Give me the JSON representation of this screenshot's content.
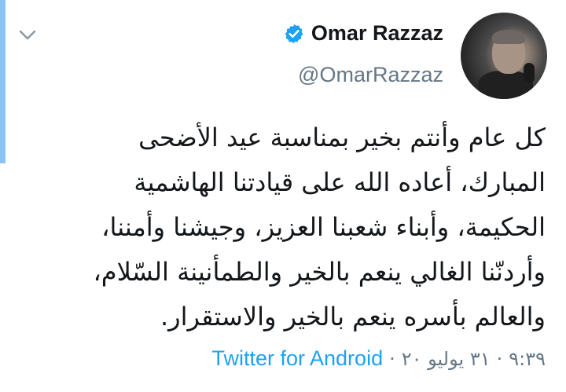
{
  "tweet": {
    "display_name": "Omar Razzaz",
    "handle": "@OmarRazzaz",
    "text": "كل عام وأنتم بخير بمناسبة عيد الأضحى المبارك، أعاده الله على قيادتنا الهاشمية الحكيمة، وأبناء شعبنا العزيز، وجيشنا وأمننا، وأردنّنا الغالي ينعم بالخير والطمأنينة السّلام، والعالم بأسره ينعم بالخير والاستقرار.",
    "time": "٩:٣٩",
    "date": "٣١ يوليو ٢٠",
    "separator": "·",
    "source": "Twitter for Android"
  },
  "icons": {
    "menu": "chevron-down-icon",
    "verified": "verified-badge-icon"
  },
  "colors": {
    "accent": "#1da1f2",
    "accent_bar": "#8bc3f3",
    "text": "#14171a",
    "muted": "#657786"
  }
}
